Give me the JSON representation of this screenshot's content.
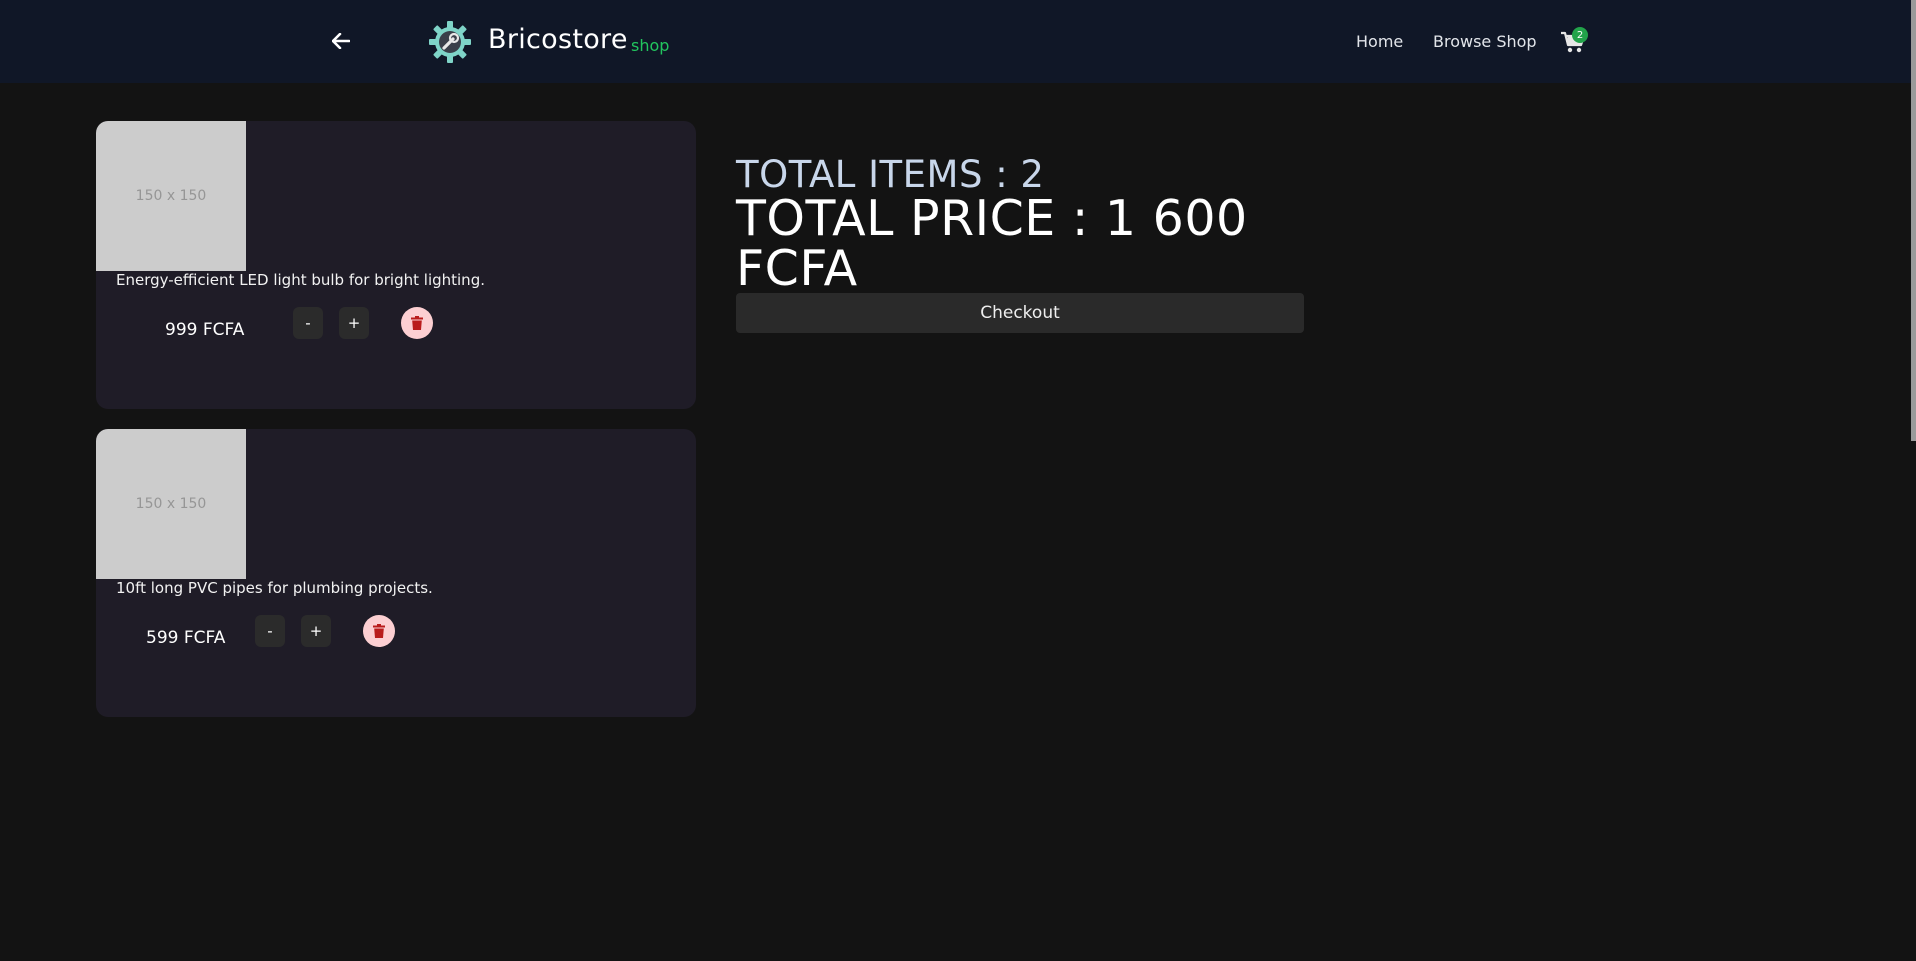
{
  "header": {
    "brand_name": "Bricostore",
    "brand_tag": "shop",
    "nav": {
      "home": "Home",
      "browse": "Browse Shop"
    },
    "cart_count": "2",
    "back_icon": "arrow-left-icon",
    "logo_icon": "gear-wrench-logo",
    "cart_icon": "shopping-cart-icon"
  },
  "cart": {
    "items": [
      {
        "image_placeholder": "150 x 150",
        "description": "Energy-efficient LED light bulb for bright lighting.",
        "price": "999 FCFA",
        "decrement_label": "-",
        "increment_label": "+",
        "delete_icon": "trash-icon"
      },
      {
        "image_placeholder": "150 x 150",
        "description": "10ft long PVC pipes for plumbing projects.",
        "price": "599 FCFA",
        "decrement_label": "-",
        "increment_label": "+",
        "delete_icon": "trash-icon"
      }
    ]
  },
  "summary": {
    "total_items": "TOTAL ITEMS : 2",
    "total_price": "TOTAL PRICE : 1 600 FCFA",
    "checkout_label": "Checkout"
  },
  "colors": {
    "page_bg": "#131313",
    "header_bg": "#101727",
    "card_bg": "#1f1c27",
    "accent_green": "#22c55e",
    "delete_bg": "#fccfd2",
    "delete_icon": "#b91c1c"
  }
}
